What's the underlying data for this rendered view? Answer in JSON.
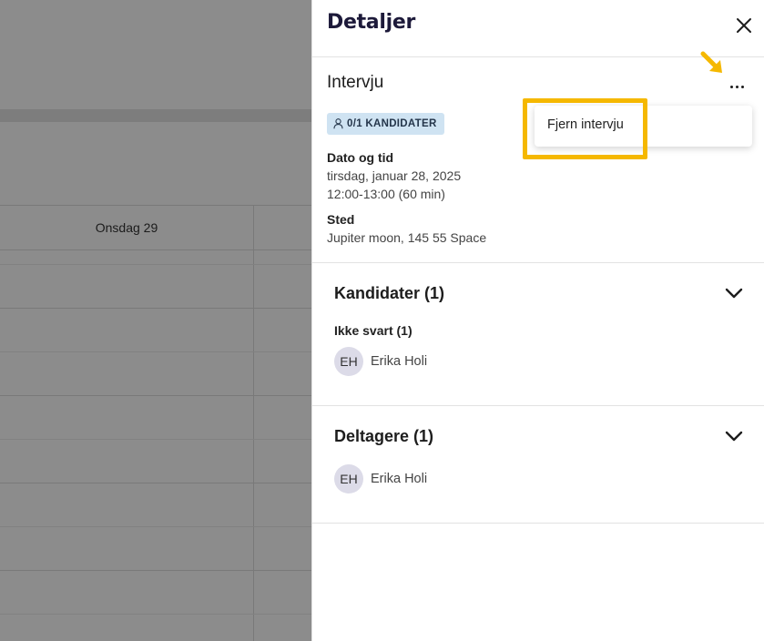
{
  "calendar": {
    "day_header": "Onsdag 29"
  },
  "panel": {
    "title": "Detaljer",
    "close_icon": "close-icon"
  },
  "event": {
    "title": "Intervju",
    "more_icon": "more-horizontal-icon",
    "badge_icon": "person-icon",
    "badge_label": "0/1 KANDIDATER",
    "date_label": "Dato og tid",
    "date_value": "tirsdag, januar 28, 2025",
    "time_value": "12:00-13:00 (60 min)",
    "location_label": "Sted",
    "location_value": "Jupiter moon, 145 55 Space"
  },
  "menu": {
    "items": [
      {
        "label": "Fjern intervju"
      }
    ]
  },
  "annotation": {
    "highlight_color": "#f5b800"
  },
  "candidates": {
    "title": "Kandidater (1)",
    "group_label": "Ikke svart (1)",
    "people": [
      {
        "initials": "EH",
        "name": "Erika Holi"
      }
    ]
  },
  "participants": {
    "title": "Deltagere (1)",
    "people": [
      {
        "initials": "EH",
        "name": "Erika Holi"
      }
    ]
  },
  "colors": {
    "badge_bg": "#cfe3f2",
    "title_color": "#1d1a3a",
    "avatar_bg": "#dcdbe8"
  }
}
